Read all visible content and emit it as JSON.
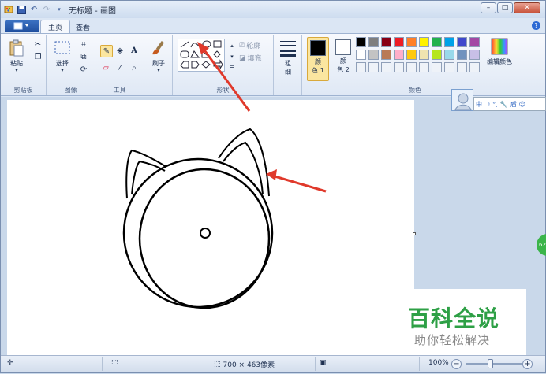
{
  "window": {
    "title": "无标题 - 画图",
    "minimize": "–",
    "maximize": "□",
    "close": "✕"
  },
  "tabs": [
    "主页",
    "查看"
  ],
  "ribbon": {
    "clipboard": {
      "paste_label": "粘贴",
      "group_label": "剪贴板"
    },
    "image": {
      "select_label": "选择",
      "group_label": "图像"
    },
    "tools": {
      "group_label": "工具"
    },
    "brushes": {
      "label": "刷子"
    },
    "shapes": {
      "outline_label": "轮廓",
      "fill_label": "填充",
      "group_label": "形状"
    },
    "size": {
      "label_line1": "粗",
      "label_line2": "细"
    },
    "color1": {
      "label_line1": "颜",
      "label_line2": "色 1"
    },
    "color2": {
      "label_line1": "颜",
      "label_line2": "色 2"
    },
    "edit_colors": "编辑颜色",
    "colors_group_label": "颜色"
  },
  "palette": [
    "#000000",
    "#7f7f7f",
    "#880015",
    "#ed1c24",
    "#ff7f27",
    "#fff200",
    "#22b14c",
    "#00a2e8",
    "#3f48cc",
    "#a349a4",
    "#ffffff",
    "#c3c3c3",
    "#b97a57",
    "#ffaec9",
    "#ffc90e",
    "#efe4b0",
    "#b5e61d",
    "#99d9ea",
    "#7092be",
    "#c8bfe7"
  ],
  "ime_bar": [
    "中",
    "☽",
    "°,",
    "🔧",
    "盾",
    "☺"
  ],
  "green_bubble": "62",
  "watermark": {
    "main": "百科全说",
    "sub": "助你轻松解决"
  },
  "status": {
    "canvas_size": "700 × 463像素",
    "zoom": "100%",
    "zoom_out": "−",
    "zoom_in": "+"
  },
  "colors": {
    "accent": "#2d6ad4",
    "arrow": "#e0392b",
    "color1": "#000000",
    "color2": "#ffffff"
  }
}
